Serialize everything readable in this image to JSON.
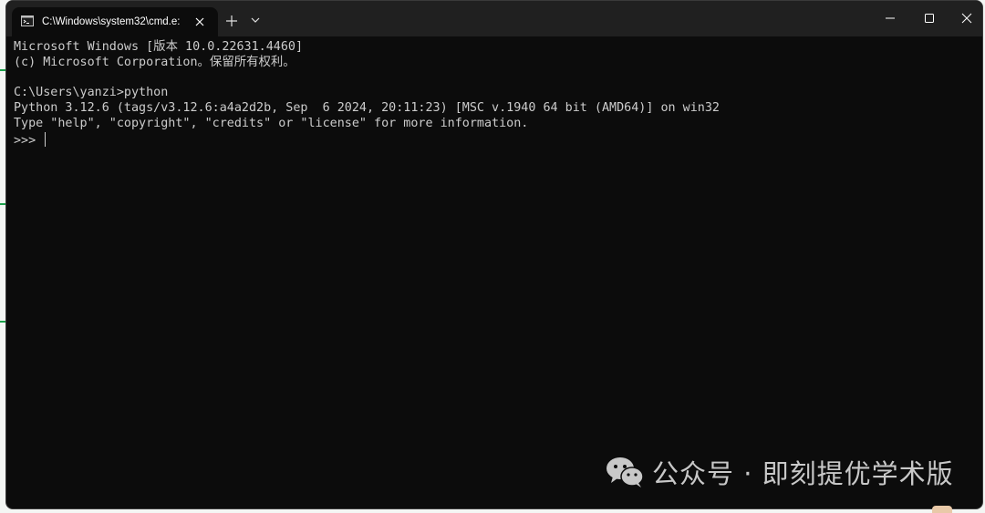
{
  "window": {
    "tab_title": "C:\\Windows\\system32\\cmd.e:",
    "icons": {
      "tab": "cmd-prompt-icon",
      "tab_close": "close-icon",
      "new_tab": "plus-icon",
      "dropdown": "chevron-down-icon",
      "minimize": "minimize-icon",
      "maximize": "maximize-icon",
      "close": "close-icon"
    }
  },
  "terminal": {
    "lines": [
      "Microsoft Windows [版本 10.0.22631.4460]",
      "(c) Microsoft Corporation。保留所有权利。",
      "",
      "C:\\Users\\yanzi>python",
      "Python 3.12.6 (tags/v3.12.6:a4a2d2b, Sep  6 2024, 20:11:23) [MSC v.1940 64 bit (AMD64)] on win32",
      "Type \"help\", \"copyright\", \"credits\" or \"license\" for more information.",
      ">>> "
    ]
  },
  "watermark": {
    "text": "公众号 · 即刻提优学术版",
    "icon": "wechat-icon"
  },
  "colors": {
    "terminal_bg": "#0c0c0c",
    "titlebar_bg": "#202020",
    "text": "#cccccc",
    "accent_green": "#1aa14a"
  }
}
